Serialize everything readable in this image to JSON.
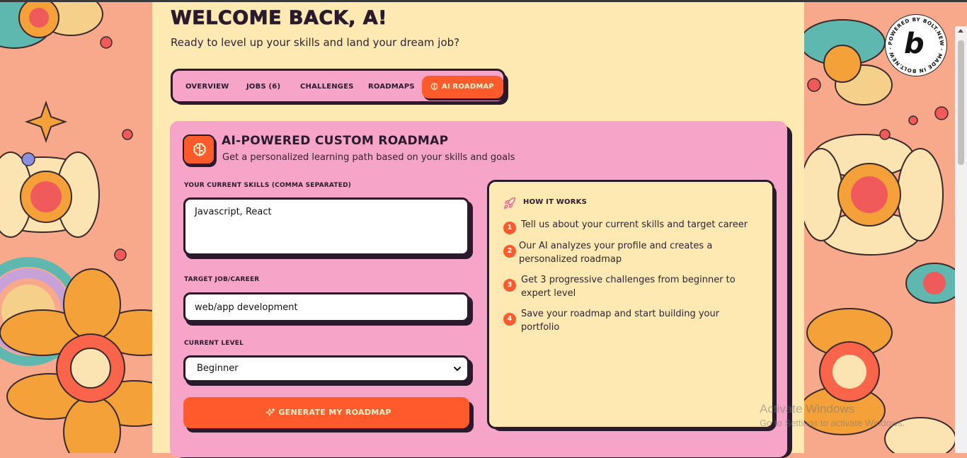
{
  "header": {
    "welcome": "WELCOME BACK, A!",
    "subtitle": "Ready to level up your skills and land your dream job?"
  },
  "tabs": [
    {
      "label": "OVERVIEW"
    },
    {
      "label": "JOBS (6)"
    },
    {
      "label": "CHALLENGES"
    },
    {
      "label": "ROADMAPS"
    },
    {
      "label": "AI ROADMAP",
      "active": true,
      "icon": "brain-icon"
    }
  ],
  "roadmap": {
    "icon": "brain-icon",
    "title": "AI-POWERED CUSTOM ROADMAP",
    "subtitle": "Get a personalized learning path based on your skills and goals",
    "skills_label": "YOUR CURRENT SKILLS (COMMA SEPARATED)",
    "skills_value": "Javascript, React",
    "target_label": "TARGET JOB/CAREER",
    "target_value": "web/app development",
    "level_label": "CURRENT LEVEL",
    "level_value": "Beginner",
    "generate_label": "GENERATE MY ROADMAP",
    "generate_icon": "sparkles-icon"
  },
  "how_it_works": {
    "icon": "rocket-icon",
    "title": "HOW IT WORKS",
    "steps": [
      {
        "num": "1",
        "text": "Tell us about your current skills and target career"
      },
      {
        "num": "2",
        "text": "Our AI analyzes your profile and creates a personalized roadmap"
      },
      {
        "num": "3",
        "text": "Get 3 progressive challenges from beginner to expert level"
      },
      {
        "num": "4",
        "text": "Save your roadmap and start building your portfolio"
      }
    ]
  },
  "badge": {
    "letter": "b",
    "ring_text": "POWERED BY BOLT.NEW · MADE IN BOLT.NEW ·"
  },
  "watermark": {
    "line1": "Activate Windows",
    "line2": "Go to Settings to activate Windows."
  },
  "colors": {
    "accent": "#ff5a2c",
    "panel_pink": "#f6a4c7",
    "cream": "#fde9b1",
    "ink": "#2a1a2e"
  }
}
